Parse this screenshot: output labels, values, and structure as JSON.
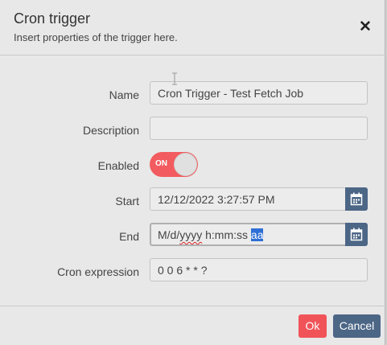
{
  "dialog": {
    "title": "Cron trigger",
    "subtitle": "Insert properties of the trigger here.",
    "close_icon": "close-icon"
  },
  "form": {
    "name_label": "Name",
    "name_value": "Cron Trigger - Test Fetch Job",
    "description_label": "Description",
    "description_value": "",
    "enabled_label": "Enabled",
    "enabled_state": "ON",
    "start_label": "Start",
    "start_value": "12/12/2022 3:27:57 PM",
    "end_label": "End",
    "end_value_pre": "M/d/",
    "end_value_misspelled": "yyyy",
    "end_value_mid": " h:mm:ss ",
    "end_value_selected": "aa",
    "cron_label": "Cron expression",
    "cron_value": "0 0 6 * * ?"
  },
  "footer": {
    "ok_label": "Ok",
    "cancel_label": "Cancel"
  },
  "colors": {
    "accent_red": "#f05459",
    "accent_blue": "#4c6686",
    "selection": "#2e6fd6"
  },
  "icons": [
    "close-icon",
    "calendar-icon",
    "text-cursor-icon"
  ]
}
